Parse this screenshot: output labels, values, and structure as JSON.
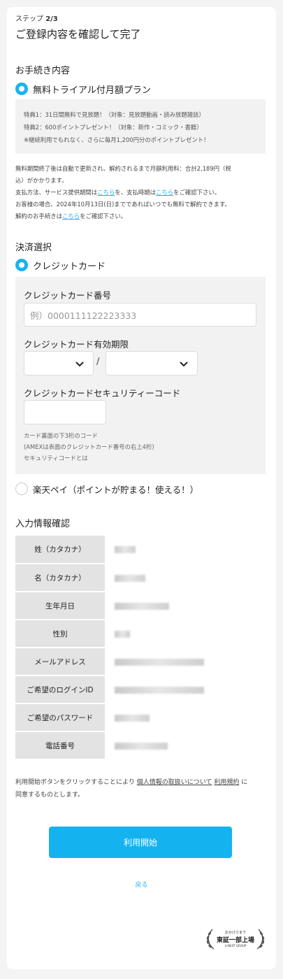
{
  "header": {
    "step_prefix": "ステップ",
    "step_value": "2/3",
    "title": "ご登録内容を確認して完了"
  },
  "procedure": {
    "title": "お手続き内容",
    "plan_label": "無料トライアル付月額プラン",
    "benefits": [
      "特典1：31日間無料で見放題！（対象：見放題動画・読み放題雑誌）",
      "特典2：600ポイントプレゼント！（対象：新作・コミック・書籍）",
      "※継続利用でもれなく、さらに毎月1,200円分のポイントプレゼント！"
    ],
    "notes": {
      "line1": "無料期間終了後は自動で更新され、解約されるまで月額利用料：合計2,189円（税",
      "line2": "込）がかかります。",
      "line3_a": "支払方法、サービス提供期間は",
      "line3_link1": "こちら",
      "line3_b": "を、支払時期は",
      "line3_link2": "こちら",
      "line3_c": "をご確認下さい。",
      "line4": "お客様の場合、2024年10月13日(日)までであればいつでも無料で解約できます。",
      "line5_a": "解約のお手続きは",
      "line5_link": "こちら",
      "line5_b": "をご確認下さい。"
    }
  },
  "payment": {
    "title": "決済選択",
    "credit_label": "クレジットカード",
    "card_number_label": "クレジットカード番号",
    "card_number_placeholder": "例）0000111122223333",
    "expiry_label": "クレジットカード有効期限",
    "expiry_separator": "/",
    "cvc_label": "クレジットカードセキュリティーコード",
    "cvc_hint1": "カード裏面の下3桁のコード",
    "cvc_hint2": "(AMEXは表面のクレジットカード番号の右上4桁)",
    "cvc_link": "セキュリティコードとは",
    "rakuten_label": "楽天ペイ（ポイントが貯まる！使える！）"
  },
  "confirm": {
    "title": "入力情報確認",
    "rows": [
      {
        "label": "姓（カタカナ）"
      },
      {
        "label": "名（カタカナ）"
      },
      {
        "label": "生年月日"
      },
      {
        "label": "性別"
      },
      {
        "label": "メールアドレス"
      },
      {
        "label": "ご希望のログインID"
      },
      {
        "label": "ご希望のパスワード"
      },
      {
        "label": "電話番号"
      }
    ]
  },
  "agreement": {
    "a": "利用開始ボタンをクリックすることにより",
    "link1": "個人情報の取扱いについて",
    "link2": "利用規約",
    "b": "に",
    "line2": "同意するものとします。"
  },
  "actions": {
    "start_button": "利用開始",
    "back_link": "戻る"
  },
  "logo": {
    "top": "おかげさまで",
    "main": "東証一部上場",
    "bottom": "U-NEXT GROUP"
  },
  "colors": {
    "accent": "#1ab3f0",
    "button": "#14b3f0",
    "panel": "#f2f2f2",
    "table_key": "#e3e3e3"
  }
}
